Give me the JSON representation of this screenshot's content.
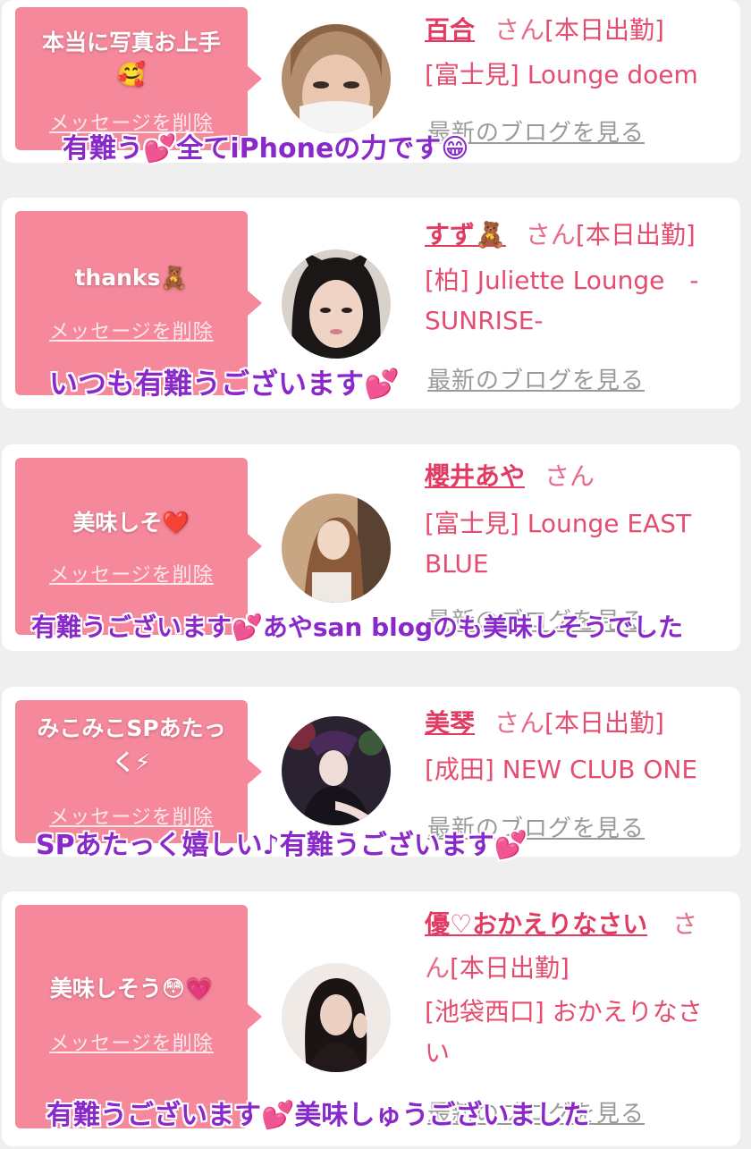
{
  "cards": [
    {
      "message": "本当に写真お上手",
      "message_emoji": "🥰",
      "delete_label": "メッセージを削除",
      "name": "百合",
      "honorific": "さん",
      "status": "[本日出勤]",
      "shop": "[富士見] Lounge doem",
      "blog_label": "最新のブログを見る",
      "caption": "有難う💕全てiPhoneの力です😁"
    },
    {
      "message": "thanks🧸",
      "delete_label": "メッセージを削除",
      "name": "すず🧸",
      "honorific": "さん",
      "status": "[本日出勤]",
      "shop_line1": "[柏] Juliette Lounge　-",
      "shop_line2": "SUNRISE-",
      "blog_label": "最新のブログを見る",
      "caption": "いつも有難うございます💕"
    },
    {
      "message": "美味しそ❤️",
      "delete_label": "メッセージを削除",
      "name": "櫻井あや",
      "honorific": "さん",
      "shop_line1": "[富士見] Lounge EAST",
      "shop_line2": "BLUE",
      "blog_label": "最新のブログを見る",
      "caption": "有難うございます💕あやsan blogのも美味しそうでした"
    },
    {
      "message_line1": "みこみこSPあたっ",
      "message_line2": "く⚡",
      "delete_label": "メッセージを削除",
      "name": "美琴",
      "honorific": "さん",
      "status": "[本日出勤]",
      "shop": "[成田] NEW CLUB ONE",
      "blog_label": "最新のブログを見る",
      "caption": "SPあたっく嬉しい♪有難うございます💕"
    },
    {
      "message": "美味しそう😳💗",
      "delete_label": "メッセージを削除",
      "name": "優♡おかえりなさい",
      "honorific_part1": "さ",
      "honorific_part2": "ん",
      "status": "[本日出勤]",
      "shop_line1": "[池袋西口] おかえりなさ",
      "shop_line2": "い",
      "blog_label": "最新のブログを見る",
      "caption": "有難うございます💕美味しゅうございました"
    }
  ],
  "colors": {
    "bubble": "#f6889c",
    "name": "#e23b63",
    "caption": "#8a29c9",
    "link_gray": "#9a9a9a"
  }
}
